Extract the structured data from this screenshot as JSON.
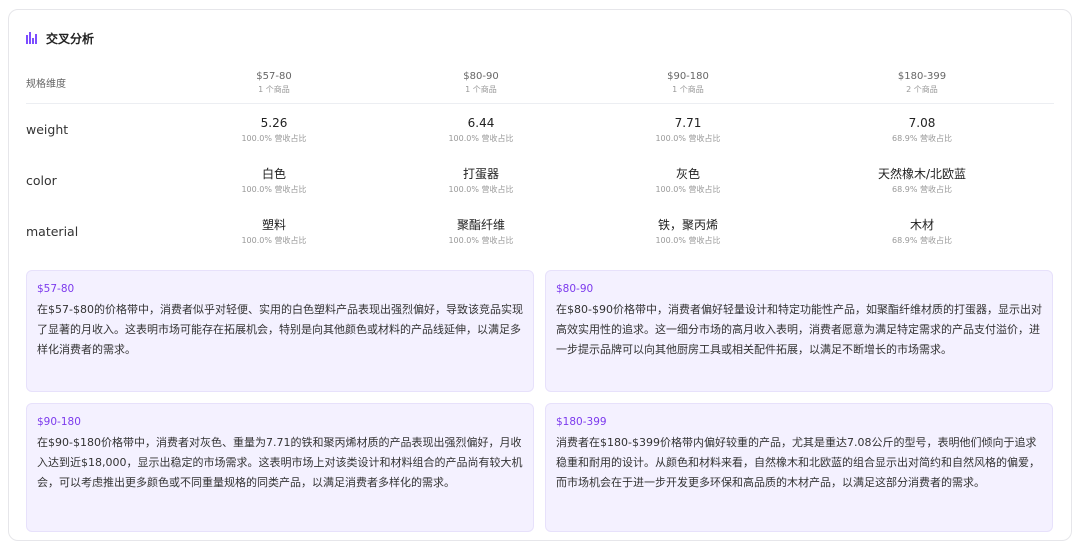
{
  "header": {
    "title": "交叉分析",
    "icon": "bar-chart-icon",
    "accent": "#7c4dff"
  },
  "table": {
    "dimension_label": "规格维度",
    "columns": [
      {
        "range": "$57-80",
        "count": "1 个商品"
      },
      {
        "range": "$80-90",
        "count": "1 个商品"
      },
      {
        "range": "$90-180",
        "count": "1 个商品"
      },
      {
        "range": "$180-399",
        "count": "2 个商品"
      }
    ],
    "rows": [
      {
        "label": "weight",
        "cells": [
          {
            "value": "5.26",
            "share": "100.0% 营收占比"
          },
          {
            "value": "6.44",
            "share": "100.0% 营收占比"
          },
          {
            "value": "7.71",
            "share": "100.0% 营收占比"
          },
          {
            "value": "7.08",
            "share": "68.9% 营收占比"
          }
        ]
      },
      {
        "label": "color",
        "cells": [
          {
            "value": "白色",
            "share": "100.0% 营收占比"
          },
          {
            "value": "打蛋器",
            "share": "100.0% 营收占比"
          },
          {
            "value": "灰色",
            "share": "100.0% 营收占比"
          },
          {
            "value": "天然橡木/北欧蓝",
            "share": "68.9% 营收占比"
          }
        ]
      },
      {
        "label": "material",
        "cells": [
          {
            "value": "塑料",
            "share": "100.0% 营收占比"
          },
          {
            "value": "聚酯纤维",
            "share": "100.0% 营收占比"
          },
          {
            "value": "铁，聚丙烯",
            "share": "100.0% 营收占比"
          },
          {
            "value": "木材",
            "share": "68.9% 营收占比"
          }
        ]
      }
    ]
  },
  "insights": [
    {
      "range": "$57-80",
      "text": "在$57-$80的价格带中，消费者似乎对轻便、实用的白色塑料产品表现出强烈偏好，导致该竞品实现了显著的月收入。这表明市场可能存在拓展机会，特别是向其他颜色或材料的产品线延伸，以满足多样化消费者的需求。"
    },
    {
      "range": "$80-90",
      "text": "在$80-$90价格带中，消费者偏好轻量设计和特定功能性产品，如聚酯纤维材质的打蛋器，显示出对高效实用性的追求。这一细分市场的高月收入表明，消费者愿意为满足特定需求的产品支付溢价，进一步提示品牌可以向其他厨房工具或相关配件拓展，以满足不断增长的市场需求。"
    },
    {
      "range": "$90-180",
      "text": "在$90-$180价格带中，消费者对灰色、重量为7.71的铁和聚丙烯材质的产品表现出强烈偏好，月收入达到近$18,000，显示出稳定的市场需求。这表明市场上对该类设计和材料组合的产品尚有较大机会，可以考虑推出更多颜色或不同重量规格的同类产品，以满足消费者多样化的需求。"
    },
    {
      "range": "$180-399",
      "text": "消费者在$180-$399价格带内偏好较重的产品，尤其是重达7.08公斤的型号，表明他们倾向于追求稳重和耐用的设计。从颜色和材料来看，自然橡木和北欧蓝的组合显示出对简约和自然风格的偏爱，而市场机会在于进一步开发更多环保和高品质的木材产品，以满足这部分消费者的需求。"
    }
  ]
}
